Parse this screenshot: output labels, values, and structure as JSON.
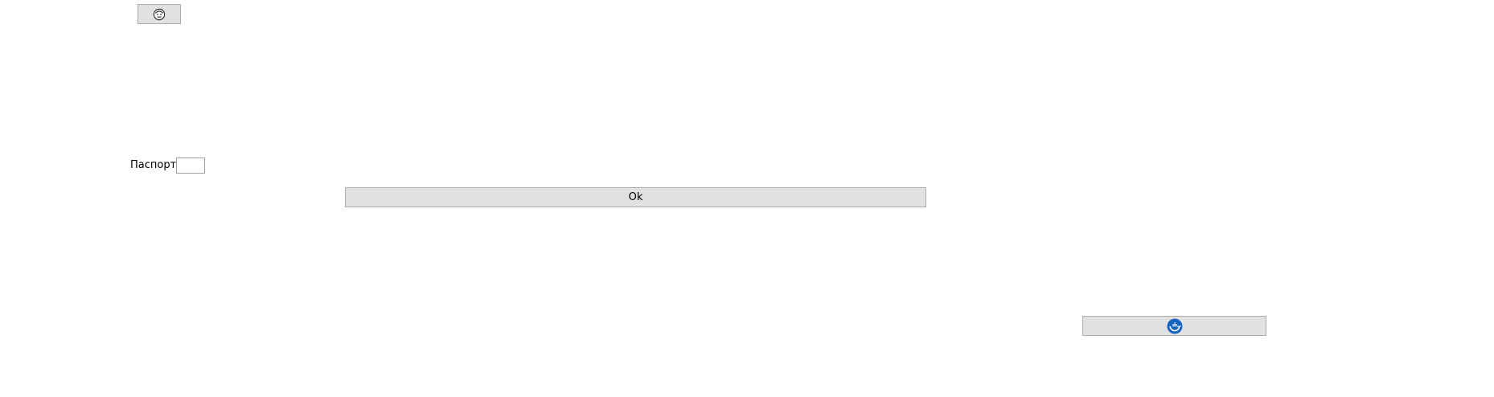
{
  "top_button": {
    "icon": "face-icon"
  },
  "passport": {
    "label": "Паспорт",
    "value": "",
    "placeholder": ""
  },
  "ok_button": {
    "label": "Ok"
  },
  "bottom_button": {
    "icon": "fingerprint-refresh-icon",
    "icon_color": "#1565c0"
  }
}
